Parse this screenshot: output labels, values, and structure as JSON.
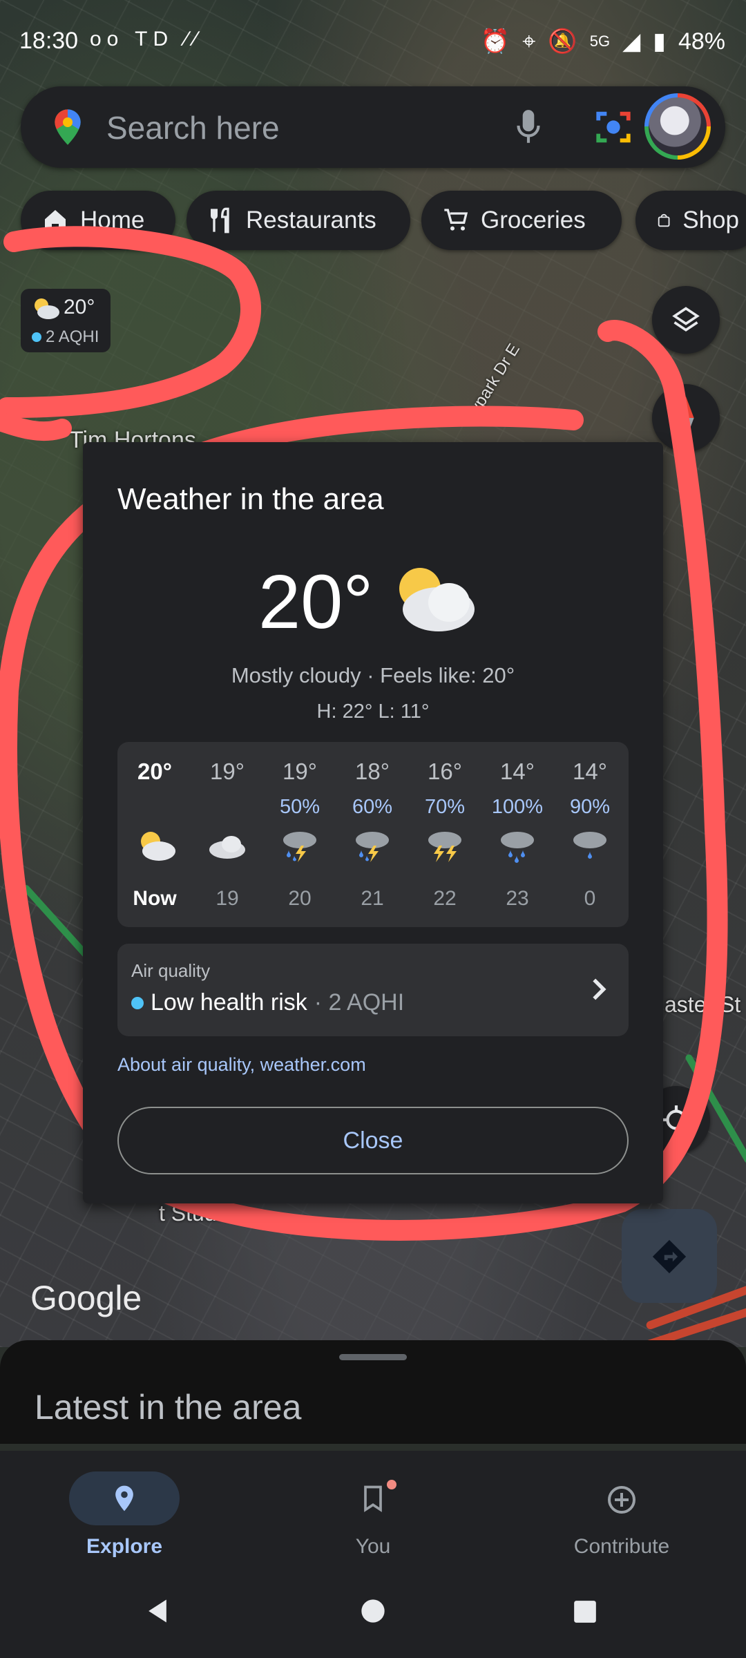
{
  "status_bar": {
    "time": "18:30",
    "left_icons": "oo TD ∕∕",
    "network": "5G",
    "battery": "48%"
  },
  "search": {
    "placeholder": "Search here"
  },
  "chips": [
    "Home",
    "Restaurants",
    "Groceries",
    "Shop"
  ],
  "weather_badge": {
    "temp": "20°",
    "aqhi": "2 AQHI"
  },
  "map_labels": {
    "tim_hortons": "Tim Hortons",
    "street": "eypark Dr E",
    "east": "aster St",
    "studio": "t Studio",
    "logo": "Google"
  },
  "weather_card": {
    "title": "Weather in the area",
    "temp": "20°",
    "condition": "Mostly cloudy · Feels like: 20°",
    "hilo": "H: 22° L: 11°",
    "forecast": [
      {
        "temp": "20°",
        "precip": "",
        "icon": "partly-cloudy",
        "hour": "Now"
      },
      {
        "temp": "19°",
        "precip": "",
        "icon": "cloudy",
        "hour": "19"
      },
      {
        "temp": "19°",
        "precip": "50%",
        "icon": "thunderstorm",
        "hour": "20"
      },
      {
        "temp": "18°",
        "precip": "60%",
        "icon": "thunderstorm",
        "hour": "21"
      },
      {
        "temp": "16°",
        "precip": "70%",
        "icon": "thunderstorm",
        "hour": "22"
      },
      {
        "temp": "14°",
        "precip": "100%",
        "icon": "heavy-rain",
        "hour": "23"
      },
      {
        "temp": "14°",
        "precip": "90%",
        "icon": "rain",
        "hour": "0"
      }
    ],
    "air_quality": {
      "label": "Air quality",
      "risk": "Low health risk",
      "value": "· 2 AQHI"
    },
    "about": "About air quality, weather.com",
    "close": "Close"
  },
  "sheet": {
    "title": "Latest in the area"
  },
  "bottom_nav": [
    {
      "label": "Explore",
      "active": true
    },
    {
      "label": "You",
      "active": false
    },
    {
      "label": "Contribute",
      "active": false
    }
  ],
  "colors": {
    "accent": "#a8c7fa",
    "card": "#202124",
    "scribble": "#ff5a5a"
  }
}
